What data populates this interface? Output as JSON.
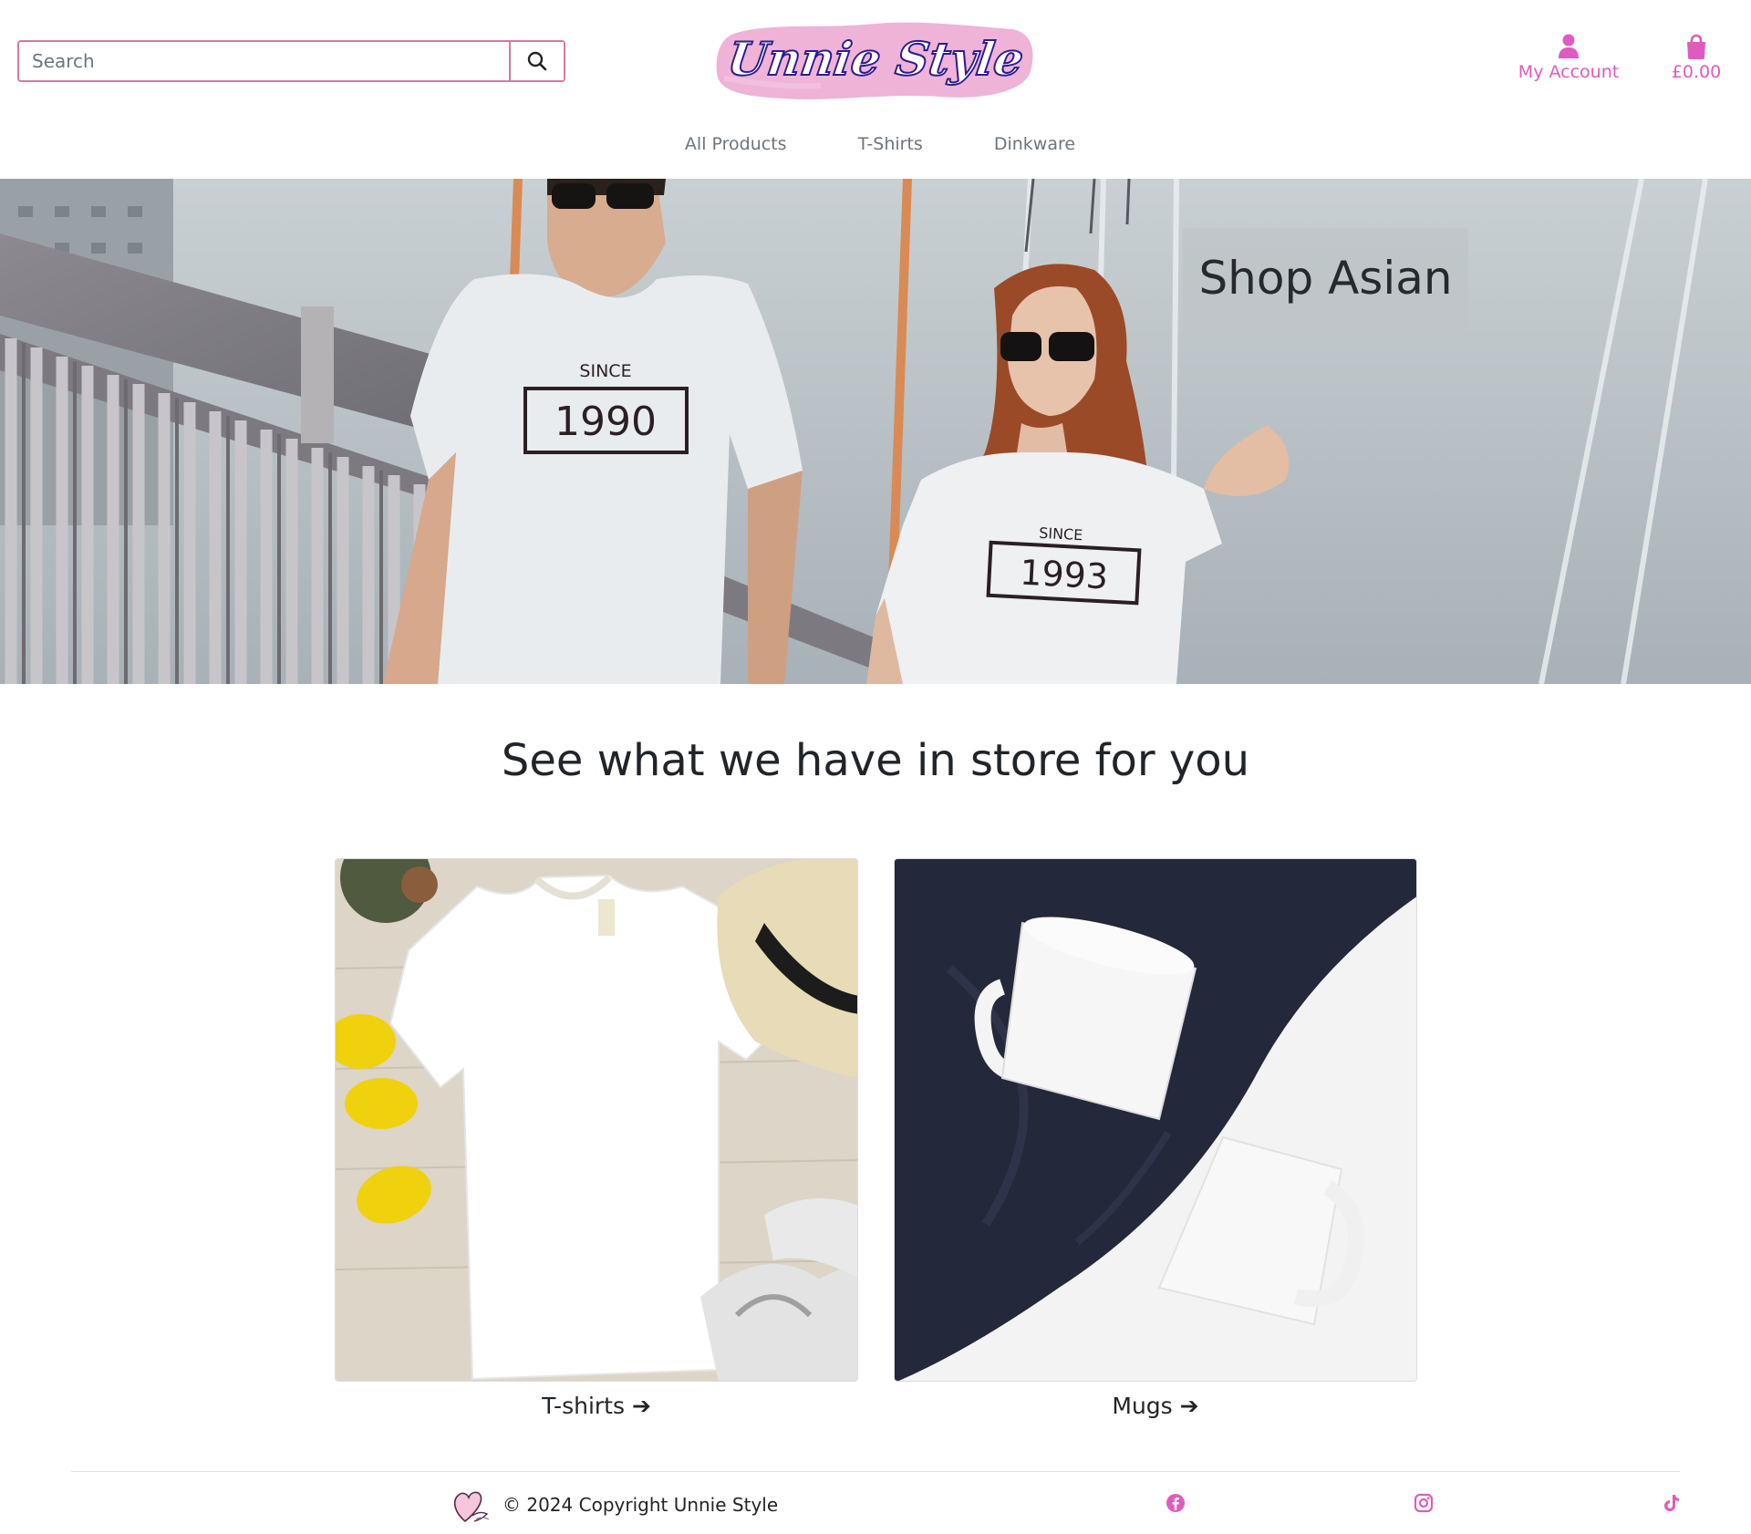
{
  "header": {
    "search": {
      "placeholder": "Search",
      "value": "",
      "button_icon": "search-icon"
    },
    "logo_text": "Unnie Style",
    "account": {
      "label": "My Account",
      "icon": "user-icon"
    },
    "bag": {
      "label": "£0.00",
      "icon": "shopping-bag-icon"
    }
  },
  "nav": {
    "items": [
      {
        "label": "All Products"
      },
      {
        "label": "T-Shirts"
      },
      {
        "label": "Dinkware"
      }
    ]
  },
  "hero": {
    "cta_label": "Shop Asian",
    "tshirt_left": {
      "since": "SINCE",
      "year": "1990"
    },
    "tshirt_right": {
      "since": "SINCE",
      "year": "1993"
    }
  },
  "section": {
    "title": "See what we have in store for you",
    "cards": [
      {
        "label": "T-shirts",
        "arrow": "➔"
      },
      {
        "label": "Mugs",
        "arrow": "➔"
      }
    ]
  },
  "footer": {
    "copyright": "© 2024 Copyright Unnie Style",
    "social_icons": [
      "facebook-icon",
      "instagram-icon",
      "tiktok-icon"
    ]
  },
  "colors": {
    "accent": "#e05bbd",
    "search_border": "#d877a3",
    "logo_brush": "#eeb3d7",
    "logo_text": "#2d1c8c",
    "text": "#212529",
    "muted": "#6c757d"
  }
}
